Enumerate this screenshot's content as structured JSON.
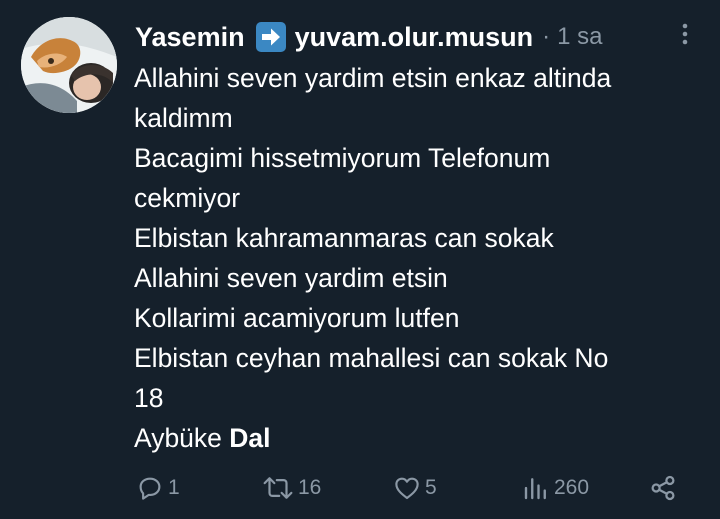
{
  "tweet": {
    "author_name": "Yasemin",
    "author_emoji": "right-arrow-emoji",
    "handle": "yuvam.olur.musun",
    "separator": "·",
    "time": "1 sa",
    "lines": [
      "Allahini seven yardim etsin enkaz altinda",
      "kaldimm",
      "Bacagimi hissetmiyorum Telefonum",
      "cekmiyor",
      "Elbistan kahramanmaras can sokak",
      "Allahini seven yardim etsin",
      "Kollarimi acamiyorum lutfen",
      "Elbistan ceyhan mahallesi can sokak No",
      "18"
    ],
    "last_line_regular": "Aybüke ",
    "last_line_bold": "Dal"
  },
  "actions": {
    "replies": "1",
    "retweets": "16",
    "likes": "5",
    "views": "260"
  },
  "colors": {
    "background": "#15202b",
    "text": "#ffffff",
    "secondary": "#8b98a5",
    "emoji_blue": "#3b88c3"
  }
}
